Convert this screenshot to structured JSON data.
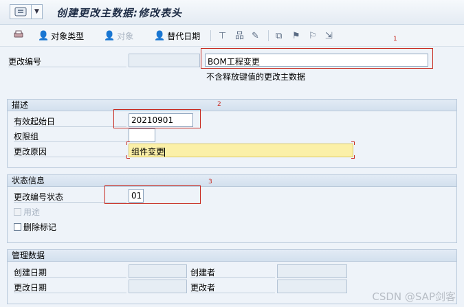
{
  "header": {
    "menu_icon": "menu-icon",
    "title": "创建更改主数据:修改表头"
  },
  "toolbar": {
    "items": [
      {
        "label": "",
        "icon": "print-icon",
        "enabled": true
      },
      {
        "label": "对象类型",
        "icon": "person-icon",
        "enabled": true
      },
      {
        "label": "对象",
        "icon": "person-icon",
        "enabled": false
      },
      {
        "label": "替代日期",
        "icon": "person-icon",
        "enabled": true
      }
    ],
    "icon_buttons": [
      "filter-icon",
      "hierarchy-icon",
      "edit-icon",
      "copy-icon",
      "flag-icon",
      "flag-settings-icon",
      "export-icon"
    ]
  },
  "annotations": [
    "1",
    "2",
    "3"
  ],
  "change_number": {
    "label": "更改编号",
    "number_value": "",
    "description": "BOM工程变更",
    "hint": "不含释放键值的更改主数据"
  },
  "description_group": {
    "title": "描述",
    "valid_from": {
      "label": "有效起始日",
      "value": "20210901"
    },
    "auth_group": {
      "label": "权限组",
      "value": ""
    },
    "reason": {
      "label": "更改原因",
      "value": "组件变更"
    }
  },
  "status_group": {
    "title": "状态信息",
    "status": {
      "label": "更改编号状态",
      "value": "01"
    },
    "usage": {
      "label": "用途",
      "checked": false,
      "enabled": false
    },
    "deletion": {
      "label": "删除标记",
      "checked": false,
      "enabled": true
    }
  },
  "admin_group": {
    "title": "管理数据",
    "created_on": {
      "label": "创建日期",
      "value": ""
    },
    "created_by": {
      "label": "创建者",
      "value": ""
    },
    "changed_on": {
      "label": "更改日期",
      "value": ""
    },
    "changed_by": {
      "label": "更改者",
      "value": ""
    }
  },
  "watermark": "CSDN @SAP剑客"
}
